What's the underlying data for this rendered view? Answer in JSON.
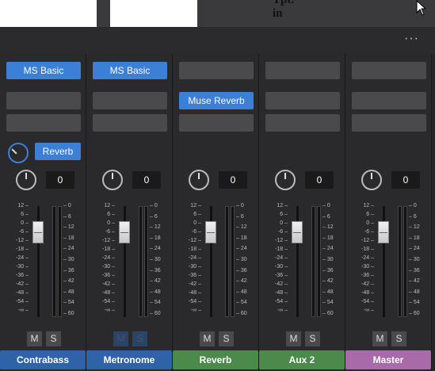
{
  "header": {
    "more_label": "···"
  },
  "score": {
    "fragment": "Tpt. in"
  },
  "scale_left": [
    "12",
    "6",
    "0",
    "-6",
    "-12",
    "-18",
    "-24",
    "-30",
    "-36",
    "-42",
    "-48",
    "-54",
    "-∞"
  ],
  "scale_right": [
    "0",
    "6",
    "12",
    "18",
    "24",
    "30",
    "36",
    "42",
    "48",
    "54",
    "60"
  ],
  "channels": [
    {
      "name": "Contrabass",
      "color": "#2f63a8",
      "slot1": "MS Basic",
      "send": "Reverb",
      "pan": "0",
      "mute": "M",
      "solo": "S",
      "fader_db": 0
    },
    {
      "name": "Metronome",
      "color": "#2f63a8",
      "slot1": "MS Basic",
      "pan": "0",
      "mute": "M",
      "solo": "S",
      "fader_db": 0
    },
    {
      "name": "Reverb",
      "color": "#4c8a4c",
      "slot1": "Muse Reverb",
      "pan": "0",
      "mute": "M",
      "solo": "S",
      "fader_db": 0
    },
    {
      "name": "Aux 2",
      "color": "#4c8a4c",
      "pan": "0",
      "mute": "M",
      "solo": "S",
      "fader_db": 0
    },
    {
      "name": "Master",
      "color": "#a86aa8",
      "pan": "0",
      "mute": "M",
      "solo": "S",
      "fader_db": 0
    }
  ]
}
